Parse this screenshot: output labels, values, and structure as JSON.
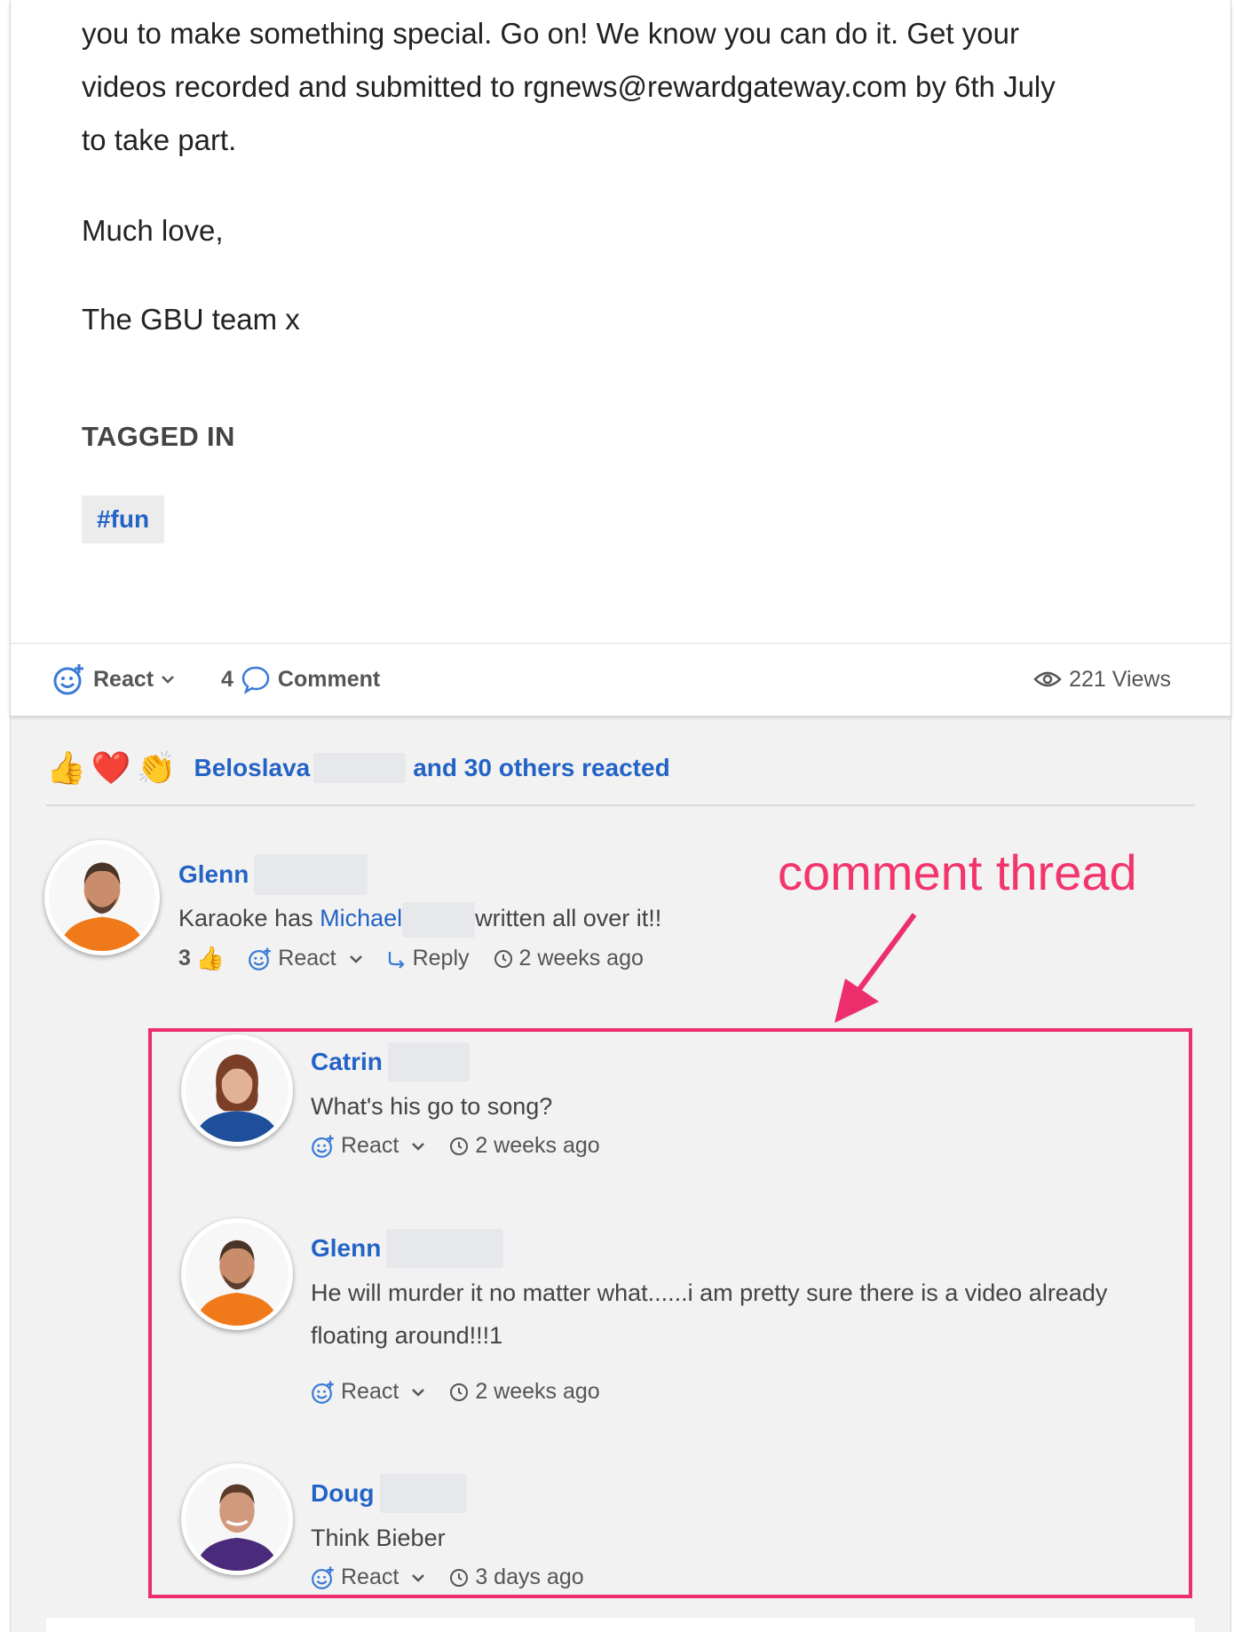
{
  "post": {
    "paragraph_lines": [
      "you to make something special. Go on! We know you can do it. Get your",
      "videos recorded and submitted to rgnews@rewardgateway.com by 6th July",
      "to take part."
    ],
    "signoff_1": "Much love,",
    "signoff_2": "The GBU team x",
    "tagged_heading": "TAGGED IN",
    "tags": [
      "#fun"
    ]
  },
  "actions": {
    "react_label": "React",
    "comment_count": "4",
    "comment_label": "Comment",
    "views": "221 Views"
  },
  "reactions": {
    "emojis": [
      "👍",
      "❤️",
      "👏"
    ],
    "first_name": "Beloslava",
    "rest": "and 30 others reacted"
  },
  "comments": [
    {
      "author": "Glenn",
      "text_before": "Karaoke has ",
      "mention": "Michael",
      "text_after": "written all over it!!",
      "like_count": "3",
      "react_label": "React",
      "reply_label": "Reply",
      "time": "2 weeks ago",
      "replies": [
        {
          "author": "Catrin",
          "text": "What's his go to song?",
          "react_label": "React",
          "time": "2 weeks ago"
        },
        {
          "author": "Glenn",
          "text_lines": [
            "He will murder it no matter what......i am pretty sure there is a video already",
            "floating around!!!1"
          ],
          "react_label": "React",
          "time": "2 weeks ago"
        },
        {
          "author": "Doug",
          "text": "Think Bieber",
          "react_label": "React",
          "time": "3 days ago"
        }
      ]
    }
  ],
  "annotation": {
    "label": "comment thread",
    "color": "#ec2f6c"
  },
  "colors": {
    "link": "#2463c6",
    "accent_pink": "#ec2f6c"
  }
}
